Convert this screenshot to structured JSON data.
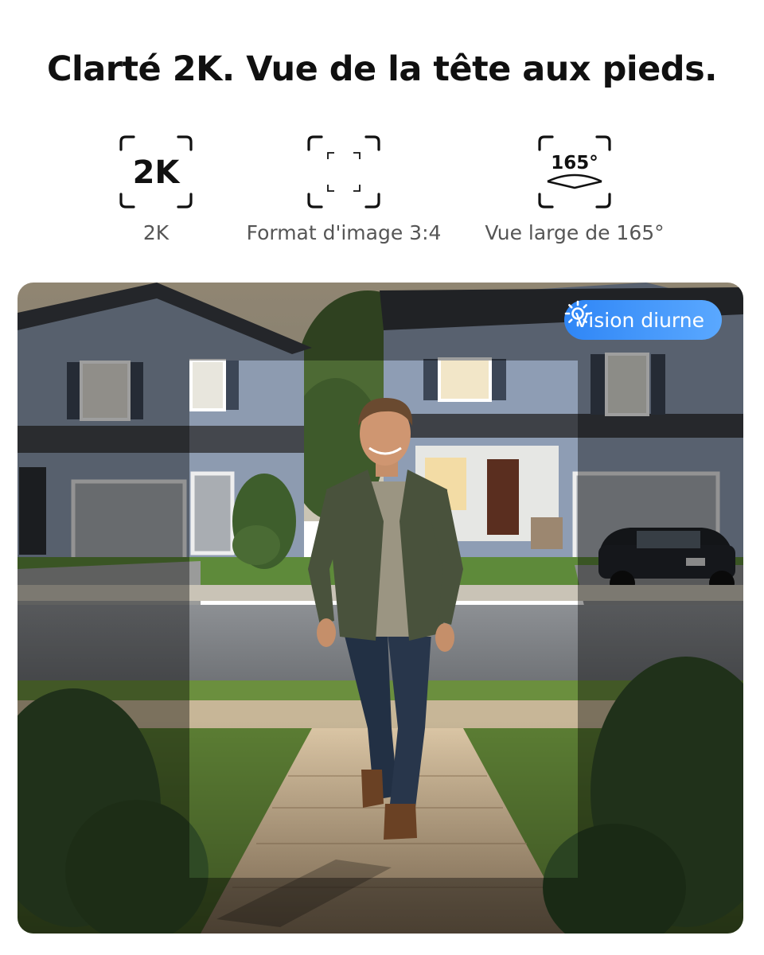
{
  "headline": "Clarté 2K. Vue de la tête aux pieds.",
  "features": [
    {
      "icon": "2k-resolution-icon",
      "icon_text": "2K",
      "label": "2K"
    },
    {
      "icon": "aspect-ratio-icon",
      "label": "Format d'image 3:4"
    },
    {
      "icon": "wide-angle-icon",
      "icon_text": "165°",
      "label": "Vue large de 165°"
    }
  ],
  "badge": {
    "icon": "sun-icon",
    "label": "Vision diurne"
  },
  "colors": {
    "badge_start": "#2f86f6",
    "badge_end": "#5aa8ff",
    "label_gray": "#555555"
  }
}
